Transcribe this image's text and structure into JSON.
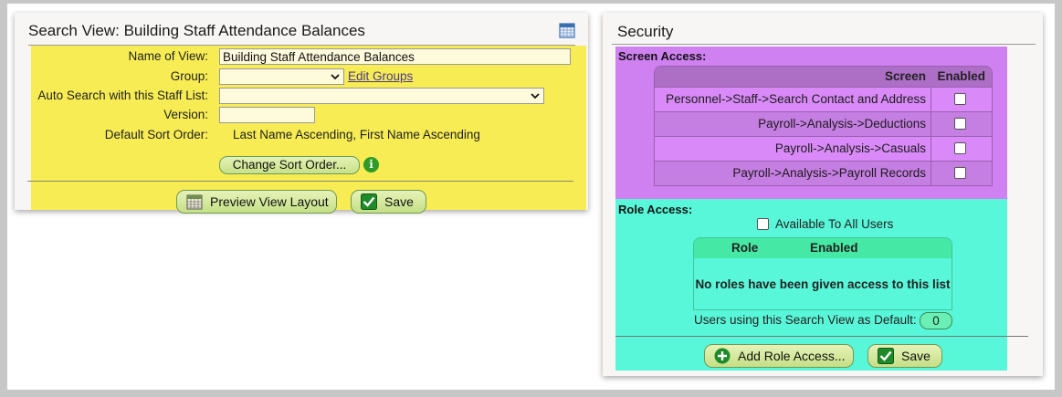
{
  "search_view": {
    "title": "Search View: Building Staff Attendance Balances",
    "name_label": "Name of View:",
    "name_value": "Building Staff Attendance Balances",
    "group_label": "Group:",
    "group_value": "",
    "edit_groups_link": "Edit Groups",
    "auto_search_label": "Auto Search with this Staff List:",
    "auto_search_value": "",
    "version_label": "Version:",
    "version_value": "",
    "sort_label": "Default Sort Order:",
    "sort_value": "Last Name Ascending, First Name Ascending",
    "change_sort_button": "Change Sort Order...",
    "info_icon_glyph": "i",
    "preview_button": "Preview View Layout",
    "save_button": "Save"
  },
  "security": {
    "title": "Security",
    "screen_access_label": "Screen Access:",
    "screen_header": "Screen",
    "enabled_header": "Enabled",
    "screens": [
      {
        "name": "Personnel->Staff->Search Contact and Address",
        "enabled": false
      },
      {
        "name": "Payroll->Analysis->Deductions",
        "enabled": false
      },
      {
        "name": "Payroll->Analysis->Casuals",
        "enabled": false
      },
      {
        "name": "Payroll->Analysis->Payroll Records",
        "enabled": false
      }
    ],
    "role_access_label": "Role Access:",
    "available_all_label": "Available To All Users",
    "available_all_checked": false,
    "role_header": "Role",
    "role_enabled_header": "Enabled",
    "no_roles_message": "No roles have been given access to this list",
    "default_users_label": "Users using this Search View as Default:",
    "default_users_count": "0",
    "add_role_button": "Add Role Access...",
    "save_button": "Save"
  },
  "colors": {
    "yellow_section": "#f7ec54",
    "purple_section": "#cf80f1",
    "teal_section": "#59f7d9",
    "button_green": "#c7e188"
  },
  "icons": {
    "calendar": "calendar-icon",
    "info": "info-icon",
    "preview": "calendar-icon",
    "save": "checkmark-icon",
    "add": "plus-circle-icon"
  }
}
